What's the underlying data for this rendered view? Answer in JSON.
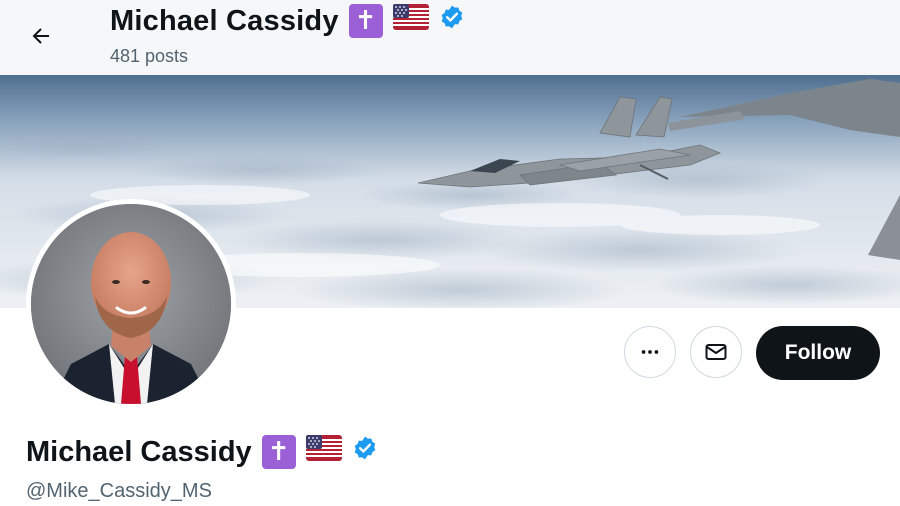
{
  "header": {
    "name": "Michael Cassidy",
    "posts_count": "481 posts",
    "badges": [
      "latin-cross-emoji",
      "us-flag-emoji",
      "verified-badge"
    ]
  },
  "profile": {
    "display_name": "Michael Cassidy",
    "handle": "@Mike_Cassidy_MS",
    "badges": [
      "latin-cross-emoji",
      "us-flag-emoji",
      "verified-badge"
    ]
  },
  "actions": {
    "follow_label": "Follow",
    "more_icon": "more-dots-icon",
    "message_icon": "envelope-icon"
  },
  "icons": {
    "back": "arrow-left-icon"
  },
  "colors": {
    "follow_bg": "#0f1419",
    "verified_blue": "#1d9bf0",
    "cross_purple": "#9b5fd6",
    "secondary_text": "#536471"
  }
}
